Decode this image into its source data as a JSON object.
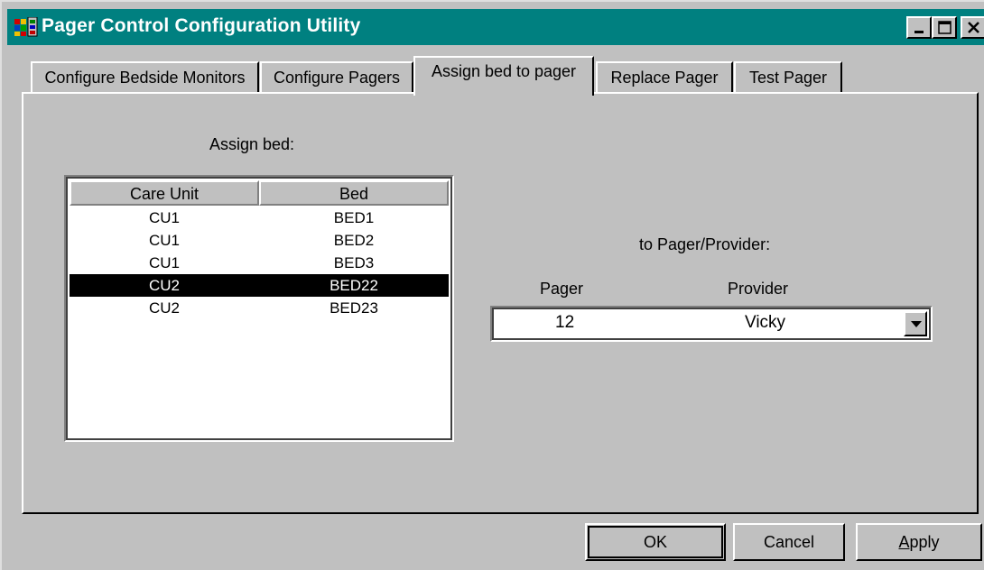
{
  "window": {
    "title": "Pager Control Configuration Utility",
    "icon": "app-grid-icon",
    "controls": [
      "minimize-icon",
      "maximize-icon",
      "close-icon"
    ]
  },
  "tabs": [
    {
      "label": "Configure Bedside Monitors",
      "active": false
    },
    {
      "label": "Configure Pagers",
      "active": false
    },
    {
      "label": "Assign bed to pager",
      "active": true
    },
    {
      "label": "Replace Pager",
      "active": false
    },
    {
      "label": "Test Pager",
      "active": false
    }
  ],
  "assign": {
    "heading": "Assign bed:",
    "columns": [
      "Care Unit",
      "Bed"
    ],
    "rows": [
      {
        "unit": "CU1",
        "bed": "BED1",
        "selected": false
      },
      {
        "unit": "CU1",
        "bed": "BED2",
        "selected": false
      },
      {
        "unit": "CU1",
        "bed": "BED3",
        "selected": false
      },
      {
        "unit": "CU2",
        "bed": "BED22",
        "selected": true
      },
      {
        "unit": "CU2",
        "bed": "BED23",
        "selected": false
      }
    ]
  },
  "pager": {
    "heading": "to Pager/Provider:",
    "col_pager": "Pager",
    "col_provider": "Provider",
    "selected_pager": "12",
    "selected_provider": "Vicky"
  },
  "buttons": {
    "ok": "OK",
    "cancel": "Cancel",
    "apply": "Apply"
  },
  "colors": {
    "titlebar": "#008080",
    "face": "#c0c0c0",
    "selection": "#000000"
  }
}
